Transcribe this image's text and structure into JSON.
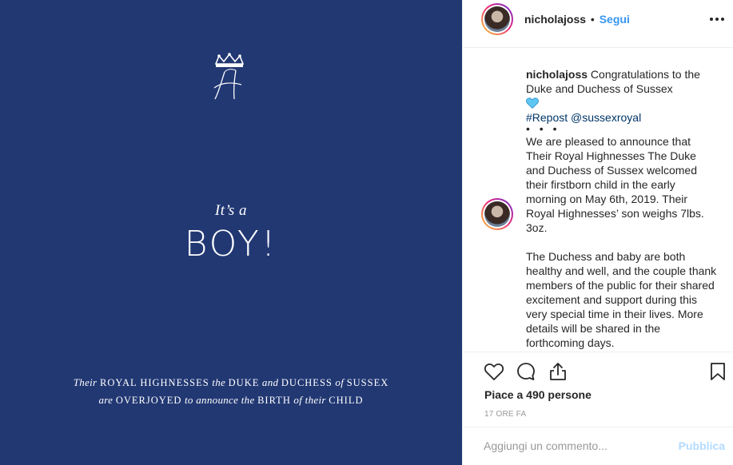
{
  "image": {
    "background_color": "#223873",
    "its_a": "It’s a",
    "boy": "BOY!",
    "line1": [
      "Their",
      "ROYAL HIGHNESSES",
      "the",
      "DUKE",
      "and",
      "DUCHESS",
      "of",
      "SUSSEX"
    ],
    "line2": [
      "are",
      "OVERJOYED",
      "to announce the",
      "BIRTH",
      "of their",
      "CHILD"
    ]
  },
  "header": {
    "username": "nicholajoss",
    "separator": "•",
    "follow_label": "Segui",
    "more_icon": "more-options-icon"
  },
  "caption": {
    "username": "nicholajoss",
    "text_line": "Congratulations to the Duke and Duchess of Sussex",
    "heart_icon": "blue-heart-icon",
    "repost": "#Repost",
    "mention": "@sussexroyal",
    "dots": "• • •",
    "paragraph1": "We are pleased to announce that Their Royal Highnesses The Duke and Duchess of Sussex welcomed their firstborn child in the early morning on May 6th, 2019. Their Royal Highnesses’ son weighs 7lbs. 3oz.",
    "paragraph2": "The Duchess and baby are both healthy and well, and the couple thank members of the public for their shared excitement and support during this very special time in their lives. More details will be shared in the forthcoming days."
  },
  "actions": {
    "likes_prefix": "Piace a",
    "likes_count": "490",
    "likes_suffix": "persone",
    "timestamp": "17 ORE FA"
  },
  "comment_box": {
    "placeholder": "Aggiungi un commento...",
    "publish_label": "Pubblica"
  },
  "colors": {
    "link_blue": "#3897f0",
    "hashtag": "#003569",
    "publish_disabled": "#b3dbff"
  }
}
